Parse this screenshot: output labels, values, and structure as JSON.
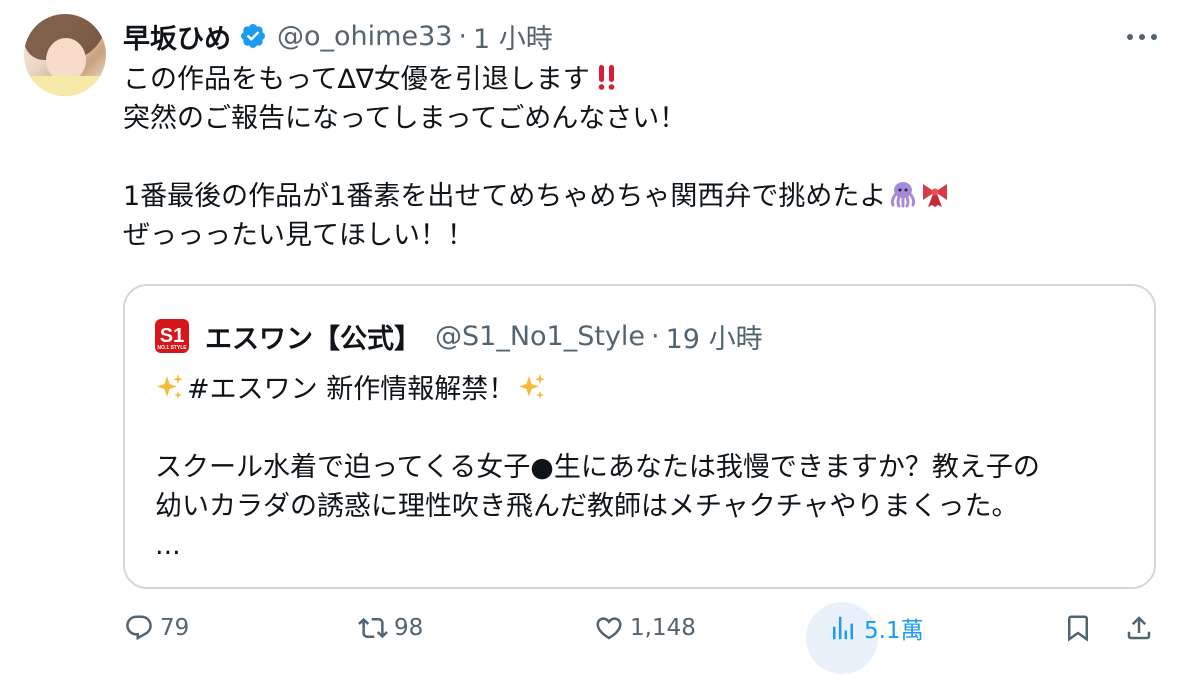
{
  "author": {
    "display_name": "早坂ひめ",
    "handle": "@o_ohime33",
    "separator": "·",
    "time": "1 小時"
  },
  "tweet": {
    "lines": [
      "この作品をもって∆∇女優を引退します",
      "突然のご報告になってしまってごめんなさい！",
      "",
      "1番最後の作品が1番素を出せてめちゃめちゃ関西弁で挑めたよ",
      "ぜっっったい見てほしい！！"
    ]
  },
  "quote": {
    "logo_text": "S1",
    "logo_subtext": "NO.1 STYLE",
    "display_name": "エスワン【公式】",
    "handle": "@S1_No1_Style",
    "separator": "·",
    "time": "19 小時",
    "lines": [
      "#エスワン 新作情報解禁！",
      "",
      "スクール水着で迫ってくる女子●生にあなたは我慢できますか？教え子の",
      "幼いカラダの誘惑に理性吹き飛んだ教師はメチャクチャやりまくった。",
      "..."
    ]
  },
  "actions": {
    "replies": "79",
    "reposts": "98",
    "likes": "1,148",
    "views": "5.1萬"
  },
  "icons": {
    "verified": "verified-badge-icon",
    "more": "more-icon",
    "reply": "reply-icon",
    "repost": "repost-icon",
    "like": "heart-icon",
    "views": "views-icon",
    "bookmark": "bookmark-icon",
    "share": "share-icon",
    "emoji_exclaim": "double-exclamation-icon",
    "emoji_octopus": "octopus-icon",
    "emoji_ribbon": "ribbon-icon",
    "emoji_sparkles": "sparkles-icon"
  },
  "colors": {
    "text": "#0f1419",
    "secondary": "#536471",
    "accent": "#1d9bf0",
    "border": "#cfd9de",
    "brand_red": "#d7161c"
  }
}
